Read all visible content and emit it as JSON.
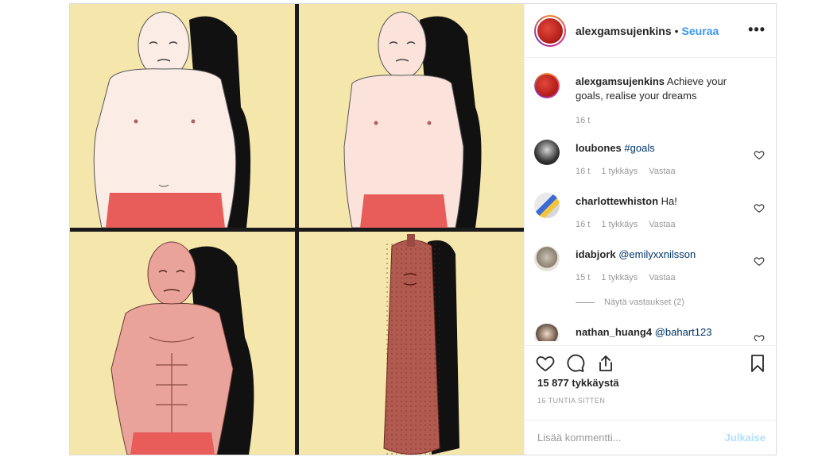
{
  "post": {
    "username": "alexgamsujenkins",
    "separator": "•",
    "follow_label": "Seuraa",
    "more_icon": "more-horizontal-icon",
    "caption": {
      "username": "alexgamsujenkins",
      "text": "Achieve your goals, realise your dreams",
      "time": "16 t"
    },
    "comments": [
      {
        "username": "loubones",
        "text": "#goals",
        "time": "16 t",
        "likes": "1 tykkäys",
        "reply": "Vastaa"
      },
      {
        "username": "charlottewhiston",
        "text": "Ha!",
        "time": "16 t",
        "likes": "1 tykkäys",
        "reply": "Vastaa"
      },
      {
        "username": "idabjork",
        "text": "@emilyxxnilsson",
        "time": "15 t",
        "likes": "1 tykkäys",
        "reply": "Vastaa",
        "view_replies": "Näytä vastaukset (2)"
      },
      {
        "username": "nathan_huang4",
        "text": "@bahart123"
      }
    ],
    "likes_count": "15 877 tykkäystä",
    "posted_ago": "16 TUNTIA SITTEN",
    "comment_placeholder": "Lisää kommentti...",
    "post_button": "Julkaise",
    "colors": {
      "accent": "#3897f0",
      "post_disabled": "#b2dffc",
      "panel_bg": "#f5e6ac",
      "underwear": "#e85c5a"
    }
  }
}
